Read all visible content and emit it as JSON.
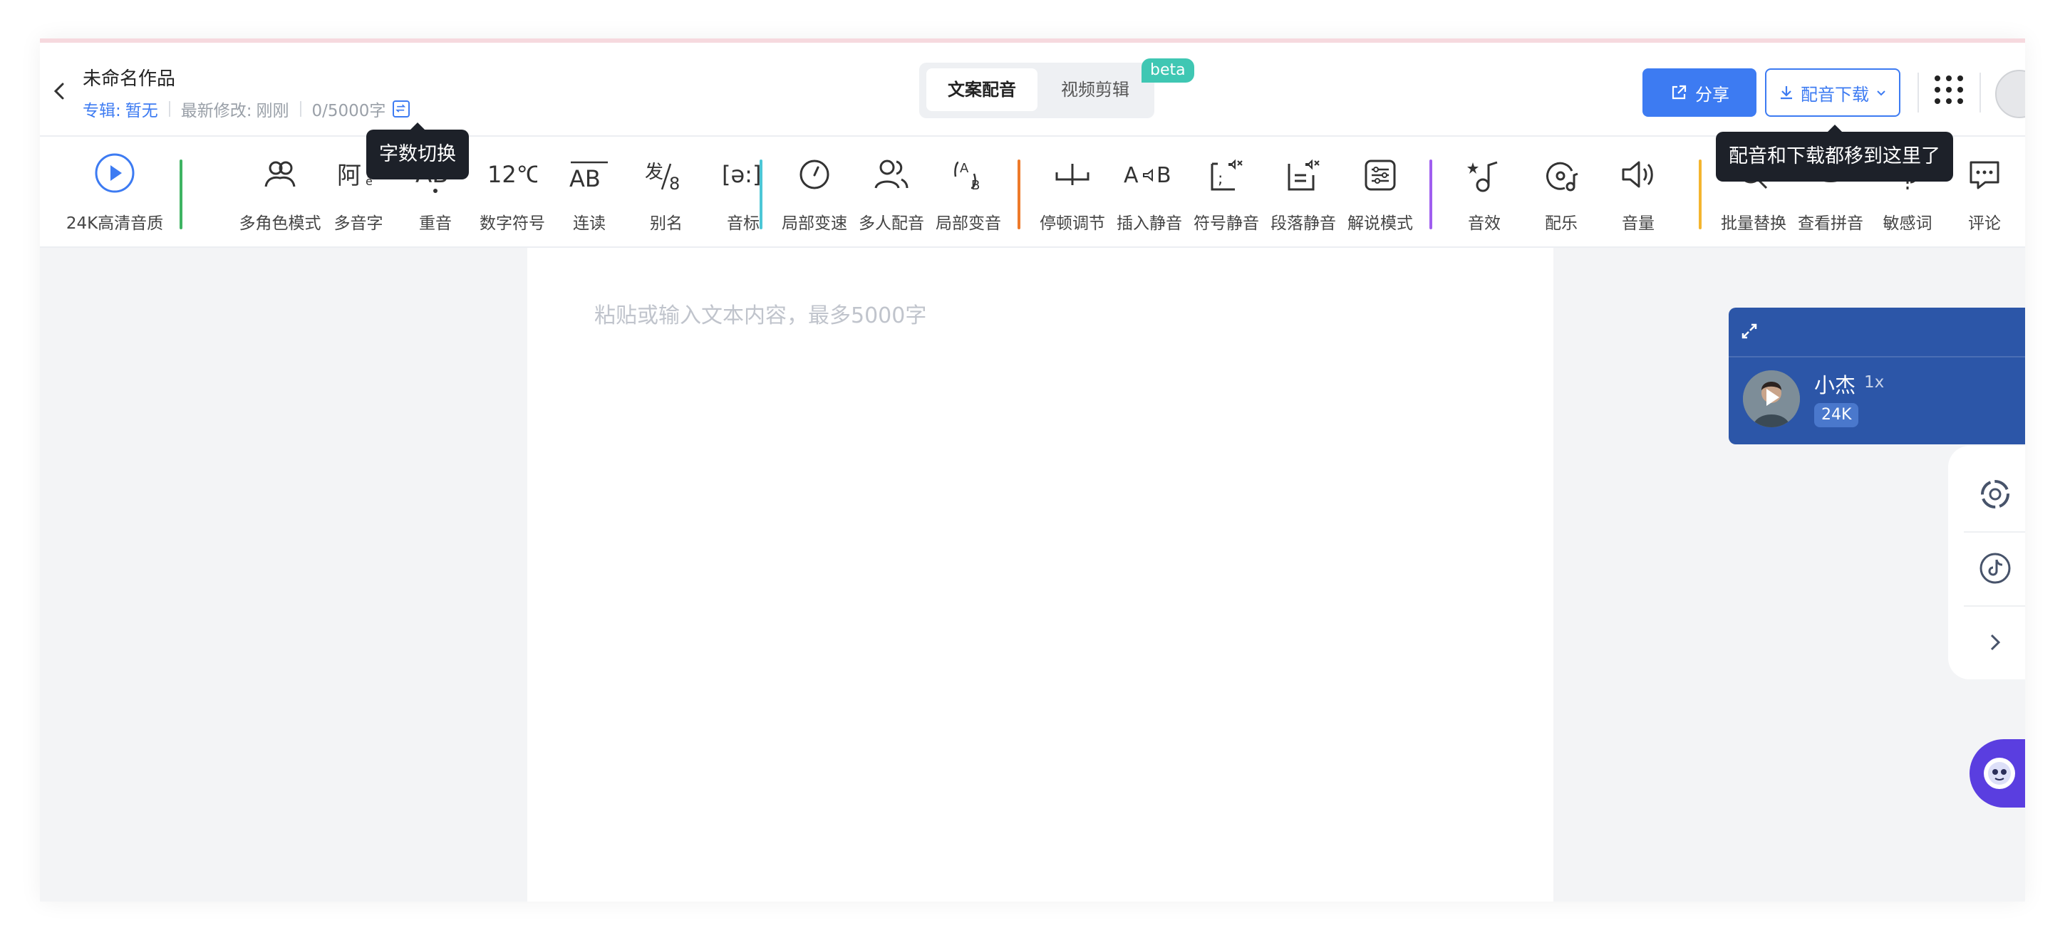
{
  "header": {
    "title": "未命名作品",
    "album_label": "专辑:",
    "album_value": "暂无",
    "modified_label": "最新修改:",
    "modified_value": "刚刚",
    "word_count": "0/5000字",
    "mode_tabs": [
      "文案配音",
      "视频剪辑"
    ],
    "beta_label": "beta",
    "share_label": "分享",
    "download_label": "配音下载"
  },
  "tooltips": {
    "word_switch": "字数切换",
    "download_moved": "配音和下载都移到这里了"
  },
  "toolbar": {
    "items": [
      "24K高清音质",
      "多角色模式",
      "多音字",
      "重音",
      "数字符号",
      "连读",
      "别名",
      "音标",
      "局部变速",
      "多人配音",
      "局部变音",
      "停顿调节",
      "插入静音",
      "符号静音",
      "段落静音",
      "解说模式",
      "音效",
      "配乐",
      "音量",
      "批量替换",
      "查看拼音",
      "敏感词",
      "评论"
    ],
    "separator_colors": [
      "#3fb463",
      "#4cc7d6",
      "#ee7a2a",
      "#a05ef0",
      "#f4b52f"
    ]
  },
  "editor": {
    "placeholder": "粘贴或输入文本内容，最多5000字"
  },
  "voice": {
    "name": "小杰",
    "speed": "1x",
    "quality_badge": "24K"
  },
  "colors": {
    "accent": "#3d7bf2",
    "voice_card": "#2c56a8",
    "tooltip": "#1d2129"
  }
}
